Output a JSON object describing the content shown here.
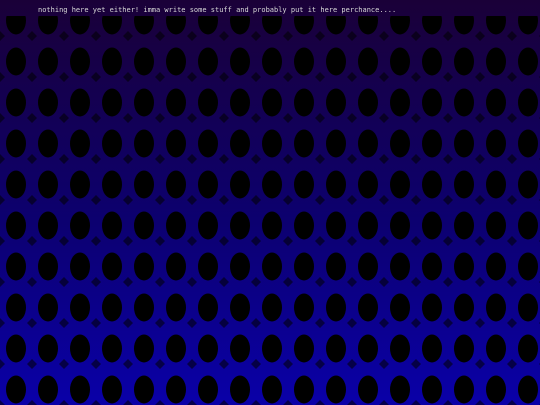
{
  "page": {
    "note_text": "nothing here yet either! imma write some stuff and probably put it here perchance....",
    "background_pattern": "dark-ovals-on-gradient",
    "colors": {
      "gradient_top": "#1a0038",
      "gradient_mid": "#0c0070",
      "gradient_bottom": "#0a00a8",
      "pattern_hole": "#000000",
      "text": "#d8d8d8"
    }
  }
}
